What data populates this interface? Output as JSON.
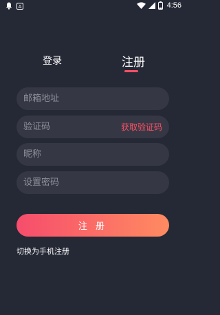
{
  "status_bar": {
    "time": "4:56",
    "battery_level": "5",
    "icons": [
      "notification-bell-icon",
      "a-app-icon",
      "wifi-icon",
      "signal-icon",
      "battery-icon"
    ]
  },
  "tabs": {
    "login": "登录",
    "register": "注册",
    "active": "register"
  },
  "form": {
    "email_placeholder": "邮箱地址",
    "code_placeholder": "验证码",
    "get_code_label": "获取验证码",
    "nickname_placeholder": "昵称",
    "password_placeholder": "设置密码",
    "submit_label": "注 册",
    "switch_label": "切换为手机注册"
  },
  "colors": {
    "background": "#252835",
    "field_bg": "#353844",
    "accent": "#ff4f66",
    "gradient_start": "#f64d6c",
    "gradient_end": "#ff8b61"
  }
}
